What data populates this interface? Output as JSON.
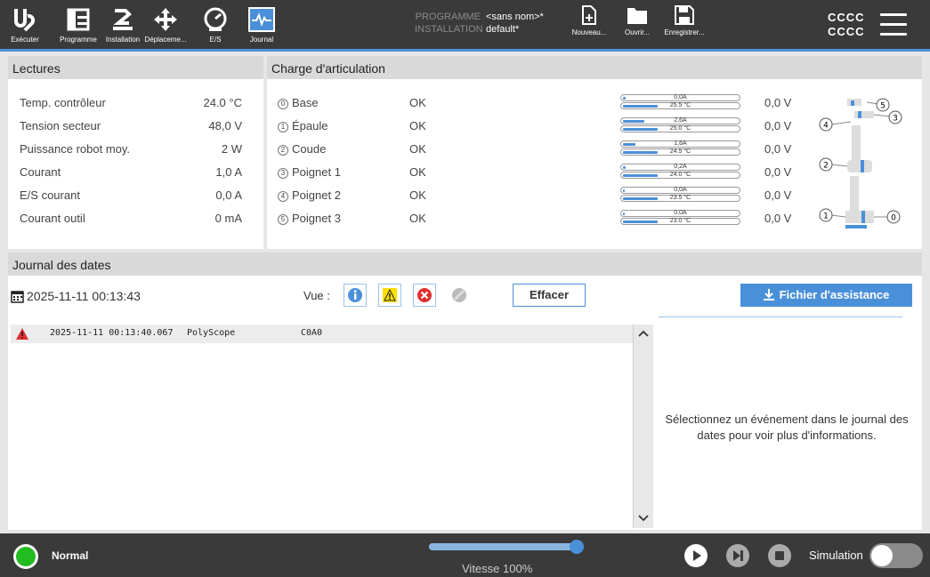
{
  "nav": {
    "items": [
      {
        "label": "Exécuter",
        "icon": "ur-logo-icon"
      },
      {
        "label": "Programme",
        "icon": "program-tree-icon"
      },
      {
        "label": "Installation",
        "icon": "robot-arm-icon"
      },
      {
        "label": "Déplaceme...",
        "icon": "move-arrows-icon"
      },
      {
        "label": "E/S",
        "icon": "io-gauge-icon"
      },
      {
        "label": "Journal",
        "icon": "waveform-log-icon"
      }
    ],
    "active": "Journal"
  },
  "program": {
    "program_key": "PROGRAMME",
    "program_value": "<sans nom>*",
    "installation_key": "INSTALLATION",
    "installation_value": "default*"
  },
  "tools": {
    "new_label": "Nouveau...",
    "open_label": "Ouvrir...",
    "save_label": "Enregistrer..."
  },
  "user": {
    "line1": "CCCC",
    "line2": "CCCC"
  },
  "colors": {
    "accent": "#4a90d9",
    "topbar": "#3a3a3a",
    "ok_green": "#22bb22",
    "error_red": "#e03030",
    "warning_yellow": "#ffe000"
  },
  "readings": {
    "title": "Lectures",
    "rows": [
      {
        "label": "Temp. contrôleur",
        "value": "24.0 °C"
      },
      {
        "label": "Tension secteur",
        "value": "48,0 V"
      },
      {
        "label": "Puissance robot moy.",
        "value": "2 W"
      },
      {
        "label": "Courant",
        "value": "1,0 A"
      },
      {
        "label": "E/S courant",
        "value": "0,0 A"
      },
      {
        "label": "Courant outil",
        "value": "0 mA"
      }
    ]
  },
  "joints": {
    "title": "Charge d'articulation",
    "rows": [
      {
        "num": "0",
        "name": "Base",
        "status": "OK",
        "current": "0,0A",
        "temp": "25.5 °C",
        "current_fraction": 0.02,
        "temp_fraction": 0.3,
        "voltage": "0,0 V"
      },
      {
        "num": "1",
        "name": "Épaule",
        "status": "OK",
        "current": "2,6A",
        "temp": "25.0 °C",
        "current_fraction": 0.18,
        "temp_fraction": 0.3,
        "voltage": "0,0 V"
      },
      {
        "num": "2",
        "name": "Coude",
        "status": "OK",
        "current": "1,6A",
        "temp": "24.5 °C",
        "current_fraction": 0.11,
        "temp_fraction": 0.3,
        "voltage": "0,0 V"
      },
      {
        "num": "3",
        "name": "Poignet 1",
        "status": "OK",
        "current": "0,2A",
        "temp": "24.0 °C",
        "current_fraction": 0.02,
        "temp_fraction": 0.3,
        "voltage": "0,0 V"
      },
      {
        "num": "4",
        "name": "Poignet 2",
        "status": "OK",
        "current": "0,0A",
        "temp": "23.5 °C",
        "current_fraction": 0.0,
        "temp_fraction": 0.3,
        "voltage": "0,0 V"
      },
      {
        "num": "5",
        "name": "Poignet 3",
        "status": "OK",
        "current": "0,0A",
        "temp": "23.0 °C",
        "current_fraction": 0.0,
        "temp_fraction": 0.3,
        "voltage": "0,0 V"
      }
    ],
    "diagram_labels": [
      "5",
      "3",
      "4",
      "2",
      "1",
      "0"
    ]
  },
  "log": {
    "title": "Journal des dates",
    "date": "2025-11-11 00:13:43",
    "view_label": "Vue :",
    "clear_label": "Effacer",
    "support_label": "Fichier d'assistance",
    "entries": [
      {
        "timestamp": "2025-11-11 00:13:40.067",
        "source": "PolyScope",
        "code": "C0A0",
        "level": "error"
      }
    ],
    "detail_placeholder": "Sélectionnez un événement dans le journal des dates pour voir plus d'informations."
  },
  "bottom": {
    "status": "Normal",
    "speed_label": "Vitesse 100%",
    "speed_fraction": 1.0,
    "simulation_label": "Simulation",
    "simulation_on": false
  }
}
